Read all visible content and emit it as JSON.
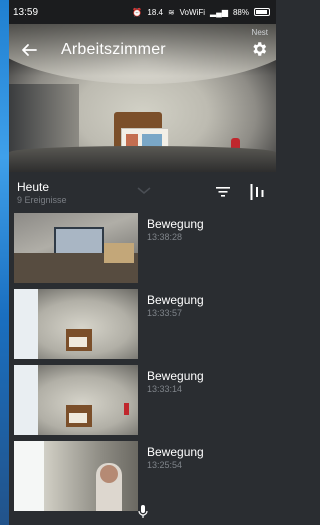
{
  "status_bar": {
    "time": "13:59",
    "network": "VoWiFi",
    "signal_text": "18.4",
    "battery": "88%"
  },
  "header": {
    "title": "Arbeitszimmer",
    "device_label": "Nest"
  },
  "events_header": {
    "day": "Heute",
    "count": "9 Ereignisse"
  },
  "events": [
    {
      "type": "Bewegung",
      "time": "13:38:28"
    },
    {
      "type": "Bewegung",
      "time": "13:33:57"
    },
    {
      "type": "Bewegung",
      "time": "13:33:14"
    },
    {
      "type": "Bewegung",
      "time": "13:25:54"
    }
  ],
  "icons": {
    "back": "back-arrow-icon",
    "settings": "gear-icon",
    "filter": "filter-icon",
    "timeline": "timeline-icon",
    "chevron": "chevron-down-icon",
    "mic": "microphone-icon"
  },
  "colors": {
    "background": "#2a2d31",
    "text_primary": "#ffffff",
    "text_secondary": "#7f848a"
  }
}
